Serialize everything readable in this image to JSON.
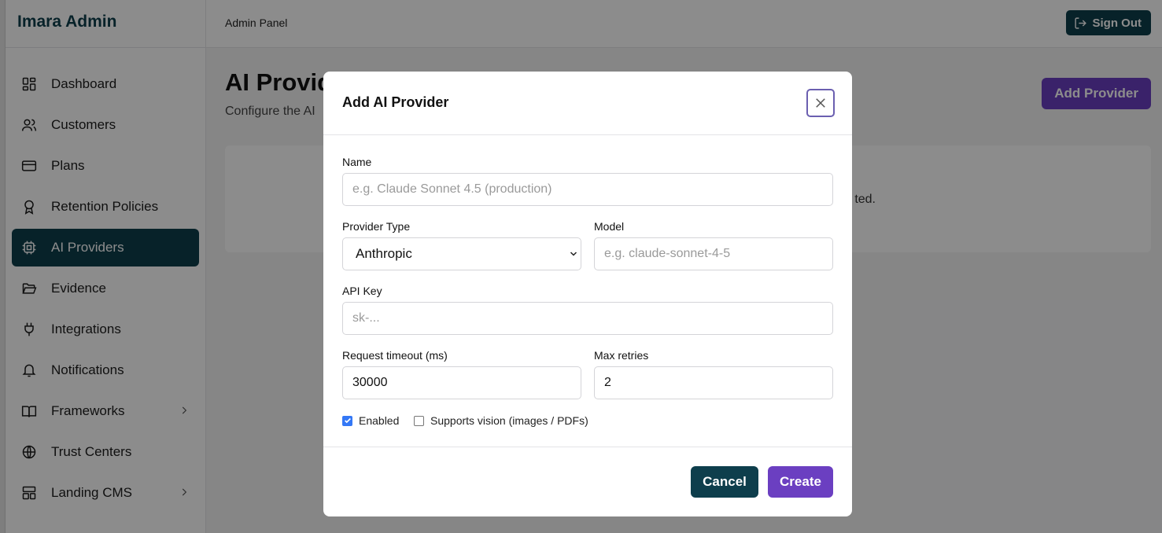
{
  "app": {
    "brand": "Imara Admin"
  },
  "topbar": {
    "breadcrumb": "Admin Panel",
    "sign_out_label": "Sign Out"
  },
  "sidebar": {
    "items": [
      {
        "label": "Dashboard",
        "icon": "grid-icon"
      },
      {
        "label": "Customers",
        "icon": "users-icon"
      },
      {
        "label": "Plans",
        "icon": "credit-card-icon"
      },
      {
        "label": "Retention Policies",
        "icon": "award-icon"
      },
      {
        "label": "AI Providers",
        "icon": "cpu-icon",
        "active": true
      },
      {
        "label": "Evidence",
        "icon": "folder-open-icon"
      },
      {
        "label": "Integrations",
        "icon": "plug-icon"
      },
      {
        "label": "Notifications",
        "icon": "bell-icon"
      },
      {
        "label": "Frameworks",
        "icon": "book-icon",
        "has_submenu": true
      },
      {
        "label": "Trust Centers",
        "icon": "globe-icon"
      },
      {
        "label": "Landing CMS",
        "icon": "layout-icon",
        "has_submenu": true
      }
    ]
  },
  "page": {
    "title": "AI Provid",
    "subtitle": "Configure the AI",
    "add_button_label": "Add Provider",
    "card_text": "ted."
  },
  "modal": {
    "title": "Add AI Provider",
    "fields": {
      "name": {
        "label": "Name",
        "placeholder": "e.g. Claude Sonnet 4.5 (production)",
        "value": ""
      },
      "provider_type": {
        "label": "Provider Type",
        "value": "Anthropic"
      },
      "model": {
        "label": "Model",
        "placeholder": "e.g. claude-sonnet-4-5",
        "value": ""
      },
      "api_key": {
        "label": "API Key",
        "placeholder": "sk-...",
        "value": ""
      },
      "timeout": {
        "label": "Request timeout (ms)",
        "value": "30000"
      },
      "retries": {
        "label": "Max retries",
        "value": "2"
      }
    },
    "checkboxes": {
      "enabled": {
        "label": "Enabled",
        "checked": true
      },
      "vision": {
        "label": "Supports vision (images / PDFs)",
        "checked": false
      }
    },
    "cancel_label": "Cancel",
    "create_label": "Create"
  },
  "colors": {
    "primary": "#0e3e4c",
    "accent": "#6b3fc1",
    "checkbox": "#3478f6"
  }
}
